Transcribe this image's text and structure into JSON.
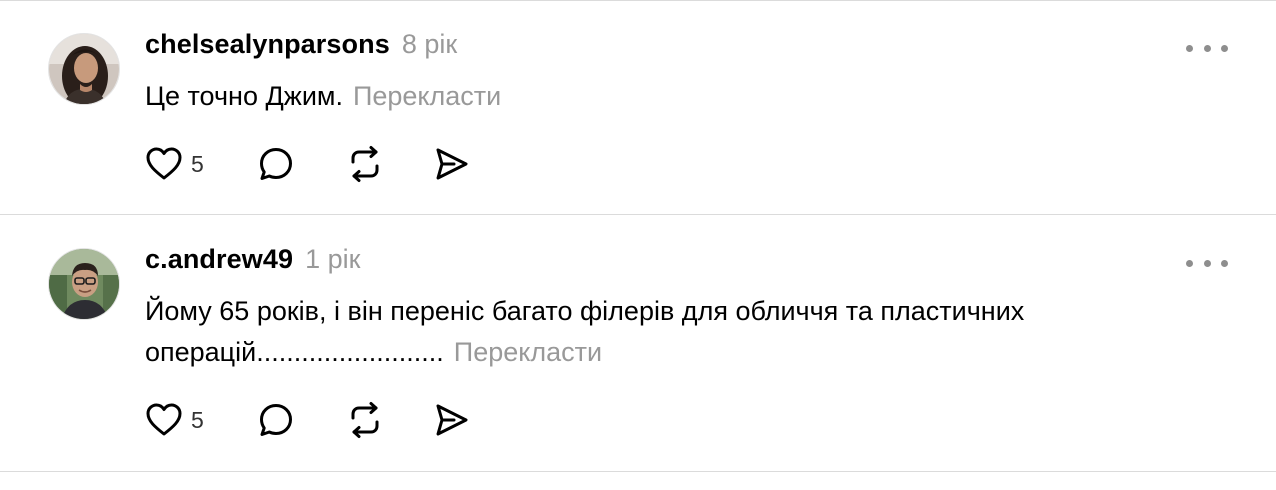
{
  "comments": [
    {
      "username": "chelsealynparsons",
      "time": "8 рік",
      "text": "Це точно Джим.",
      "translate_label": "Перекласти",
      "likes": "5",
      "avatar_icon": "user-avatar-photo"
    },
    {
      "username": "c.andrew49",
      "time": "1 рік",
      "text": "Йому 65 років, і він переніс багато філерів для обличчя та пластичних операцій.........................",
      "translate_label": "Перекласти",
      "likes": "5",
      "avatar_icon": "user-avatar-photo"
    }
  ],
  "icons": {
    "like": "heart-icon",
    "reply": "comment-bubble-icon",
    "repost": "repost-icon",
    "share": "send-icon",
    "more": "more-dots-icon"
  },
  "colors": {
    "secondary_text": "#999999",
    "divider": "#dbdbdb",
    "icon": "#000000"
  }
}
